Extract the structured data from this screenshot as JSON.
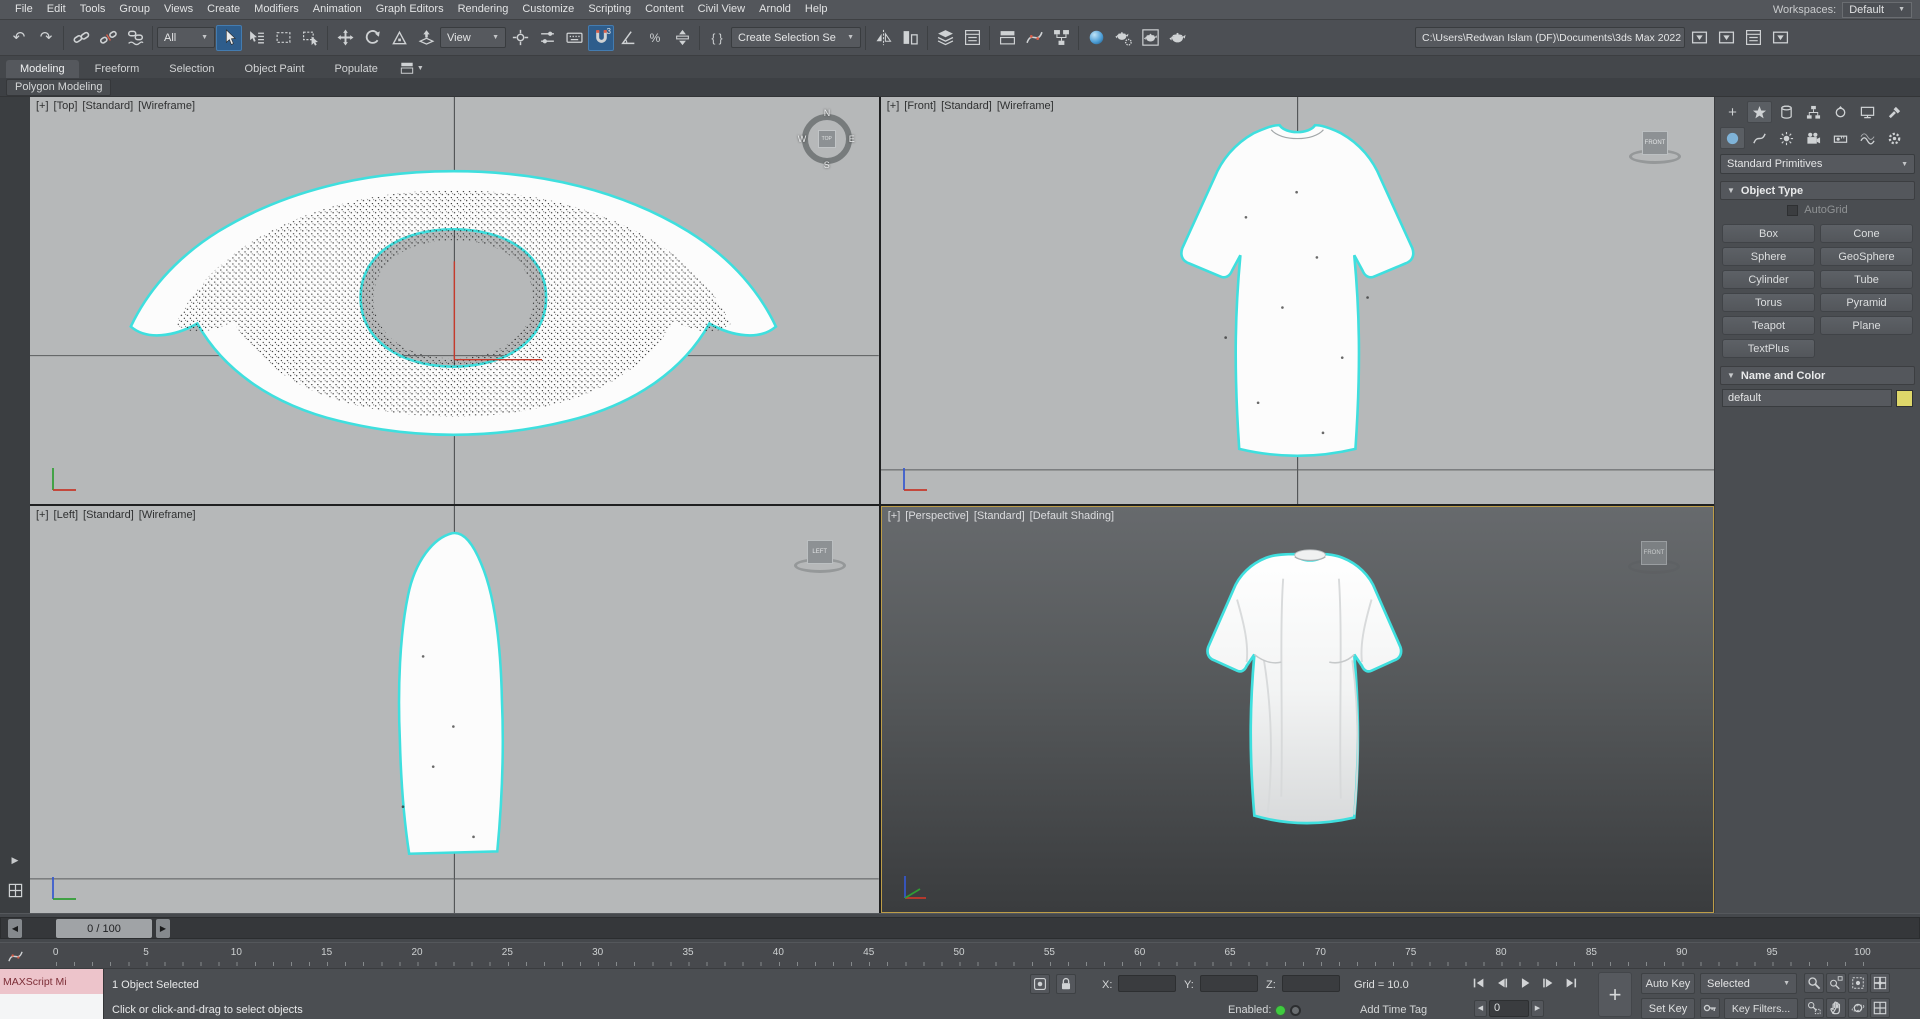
{
  "menu": {
    "items": [
      "File",
      "Edit",
      "Tools",
      "Group",
      "Views",
      "Create",
      "Modifiers",
      "Animation",
      "Graph Editors",
      "Rendering",
      "Customize",
      "Scripting",
      "Content",
      "Civil View",
      "Arnold",
      "Help"
    ],
    "workspaces_label": "Workspaces:",
    "workspaces_value": "Default"
  },
  "toolbar": {
    "selection_filter_value": "All",
    "coordinate_system_value": "View",
    "named_selection_placeholder": "Create Selection Se",
    "project_path": "C:\\Users\\Redwan Islam (DF)\\Documents\\3ds Max 2022"
  },
  "ribbon": {
    "tabs": [
      "Modeling",
      "Freeform",
      "Selection",
      "Object Paint",
      "Populate"
    ],
    "active_tab": "Modeling",
    "collapsed_panel": "Polygon Modeling"
  },
  "viewports": {
    "top": {
      "segments": [
        "[+]",
        "[Top]",
        "[Standard]",
        "[Wireframe]"
      ],
      "viewcube": {
        "n": "N",
        "e": "E",
        "s": "S",
        "w": "W",
        "face": "TOP"
      }
    },
    "front": {
      "segments": [
        "[+]",
        "[Front]",
        "[Standard]",
        "[Wireframe]"
      ],
      "viewcube_face": "FRONT"
    },
    "left": {
      "segments": [
        "[+]",
        "[Left]",
        "[Standard]",
        "[Wireframe]"
      ],
      "viewcube_face": "LEFT"
    },
    "perspective": {
      "segments": [
        "[+]",
        "[Perspective]",
        "[Standard]",
        "[Default Shading]"
      ],
      "viewcube_face": "FRONT"
    }
  },
  "command_panel": {
    "category_dropdown": "Standard Primitives",
    "object_type": {
      "title": "Object Type",
      "autogrid_label": "AutoGrid",
      "buttons": [
        "Box",
        "Cone",
        "Sphere",
        "GeoSphere",
        "Cylinder",
        "Tube",
        "Torus",
        "Pyramid",
        "Teapot",
        "Plane",
        "TextPlus"
      ]
    },
    "name_and_color": {
      "title": "Name and Color",
      "object_name": "default",
      "color_hex": "#ded76a"
    }
  },
  "timeline": {
    "frame_display": "0 / 100",
    "ticks": [
      "0",
      "5",
      "10",
      "15",
      "20",
      "25",
      "30",
      "35",
      "40",
      "45",
      "50",
      "55",
      "60",
      "65",
      "70",
      "75",
      "80",
      "85",
      "90",
      "95",
      "100"
    ]
  },
  "status_bar": {
    "maxscript_label": "MAXScript Mi",
    "selection_status": "1 Object Selected",
    "prompt": "Click or click-and-drag to select objects",
    "x_label": "X:",
    "y_label": "Y:",
    "z_label": "Z:",
    "x_value": "",
    "y_value": "",
    "z_value": "",
    "grid_label": "Grid = 10.0",
    "enabled_label": "Enabled:",
    "add_time_tag": "Add Time Tag",
    "auto_key": "Auto Key",
    "set_key": "Set Key",
    "selection_set": "Selected",
    "key_filters": "Key Filters...",
    "frame_field": "0"
  },
  "colors": {
    "selection_outline": "#3fdfde",
    "active_viewport_border": "#bd9d48",
    "toolbar_highlight": "#2e5d8c",
    "enabled_green": "#3ecb3e",
    "object_color": "#ded76a"
  }
}
